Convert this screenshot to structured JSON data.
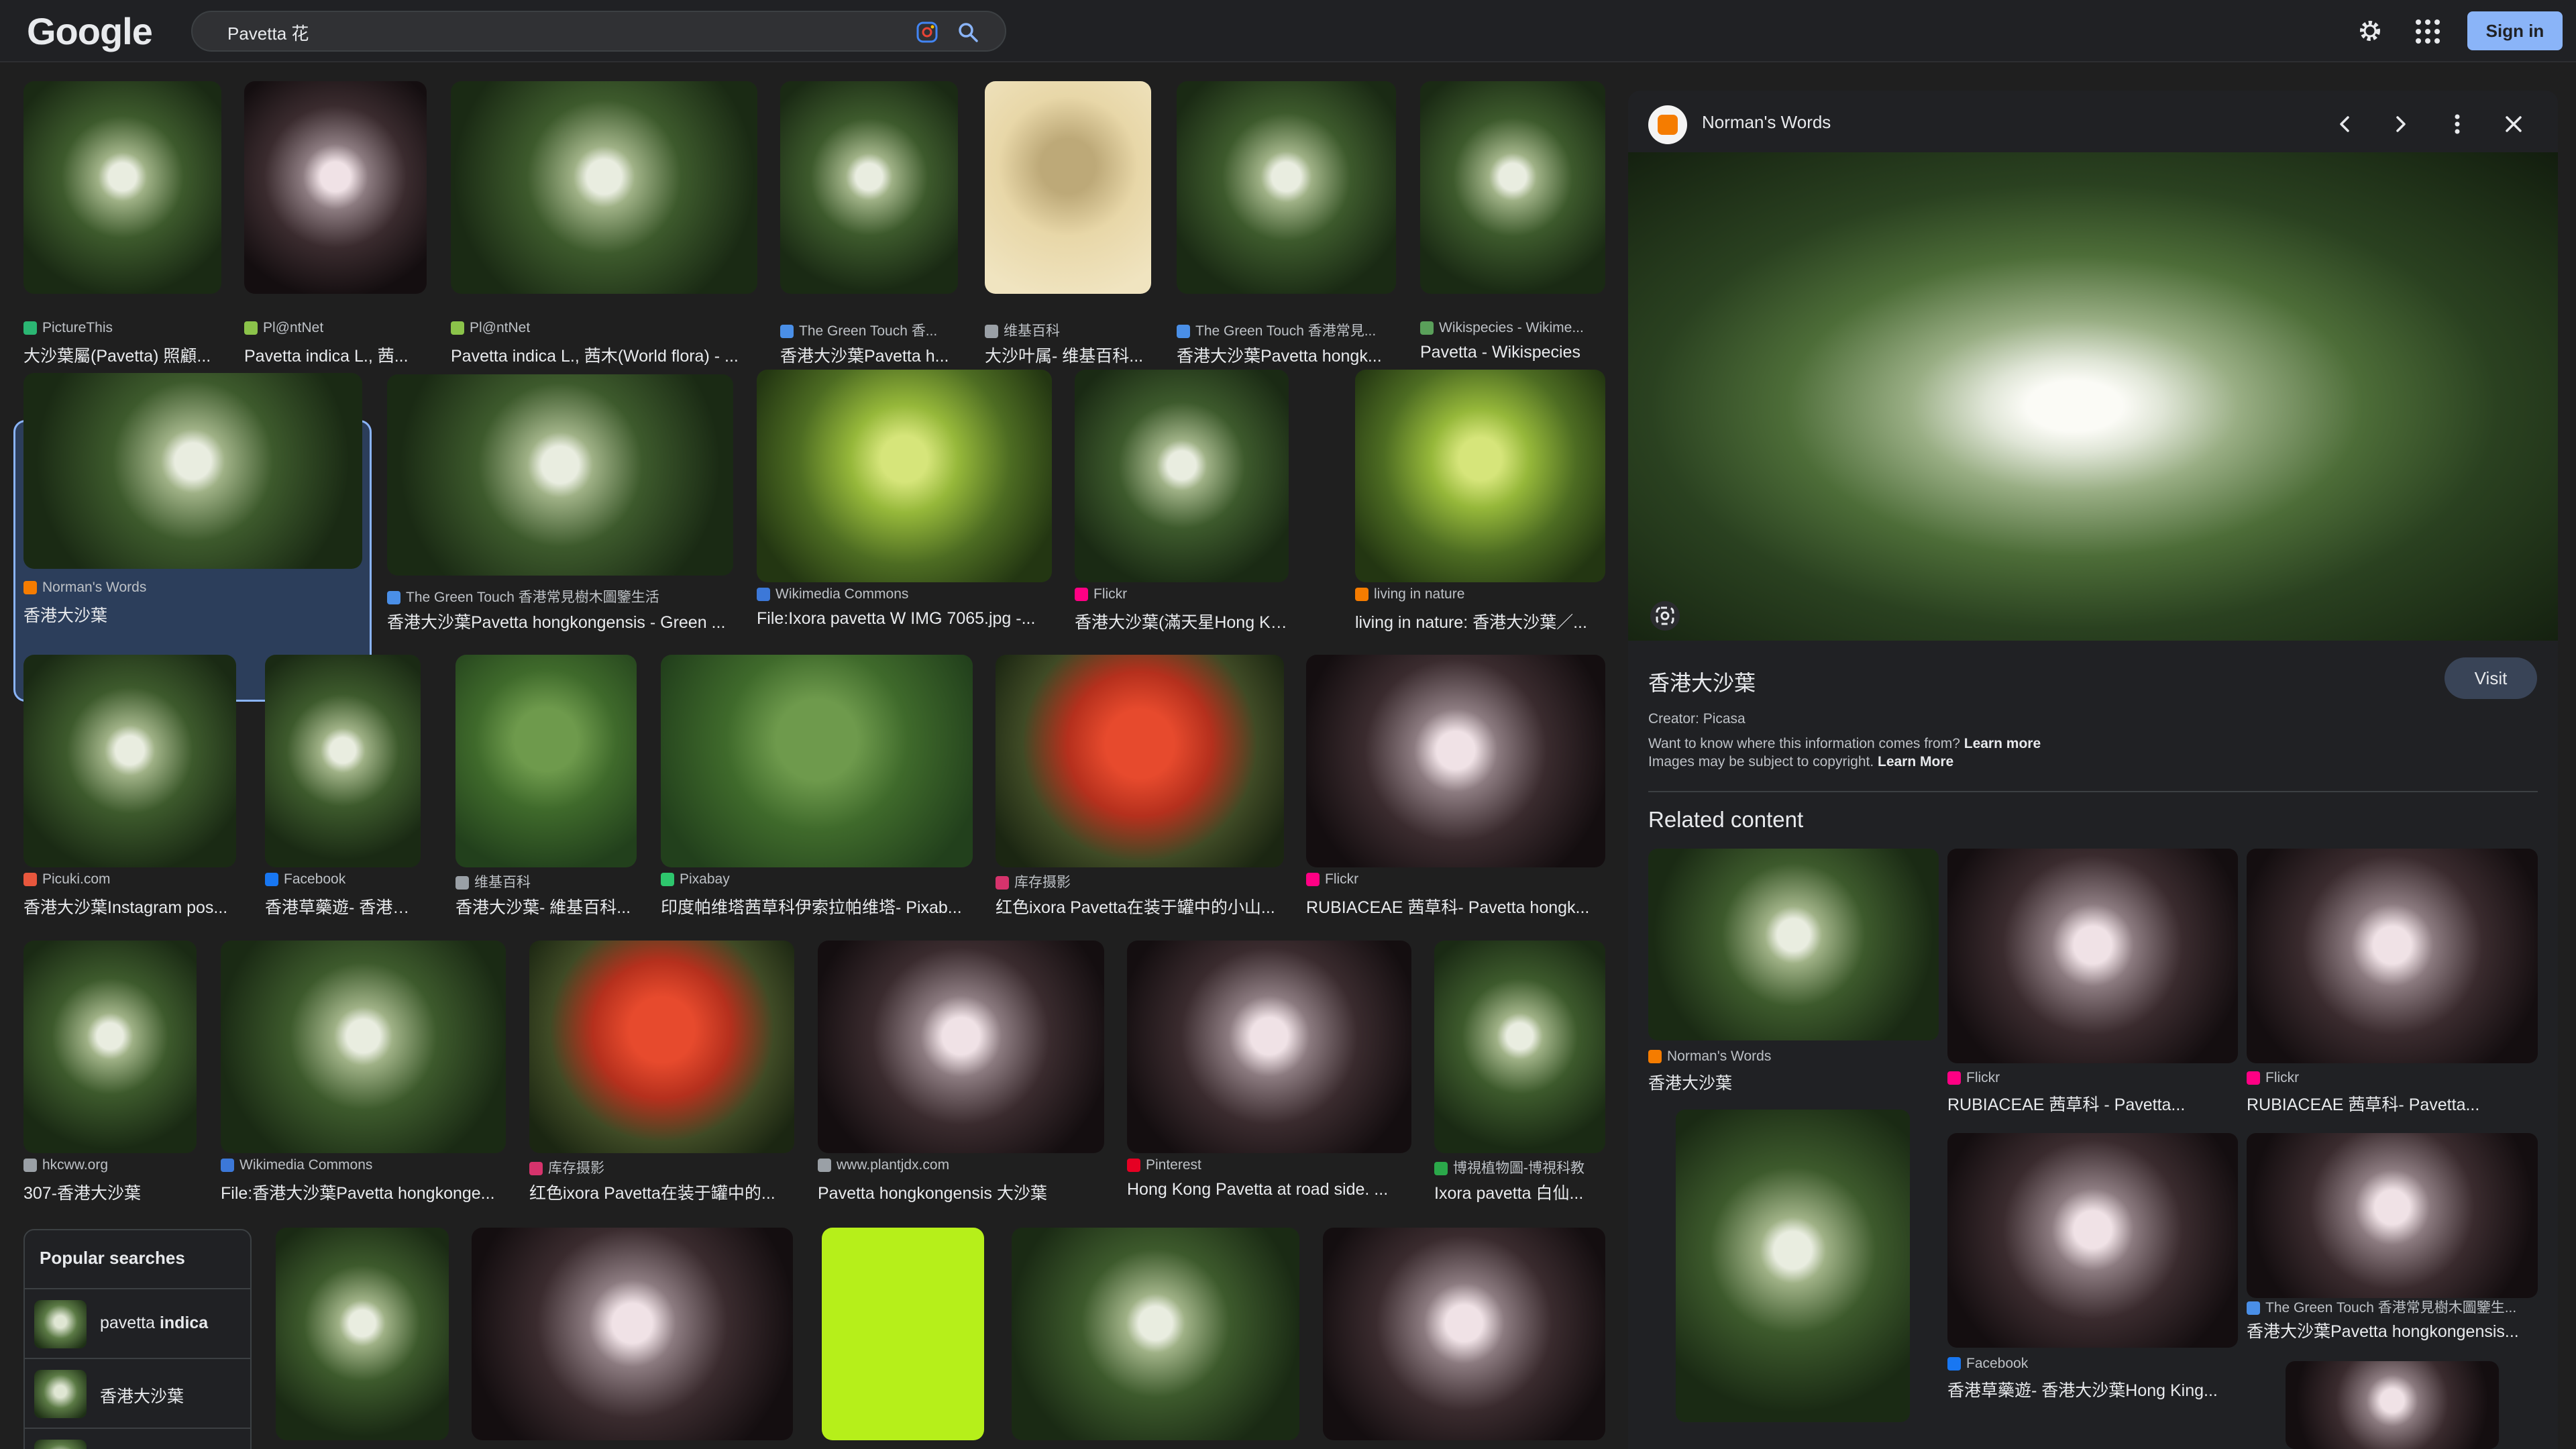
{
  "header": {
    "logo": "Google",
    "search_value": "Pavetta 花",
    "sign_in": "Sign in"
  },
  "grid": {
    "row1": [
      {
        "source": "PictureThis",
        "caption": "大沙葉屬(Pavetta) 照顧...",
        "fav": "#2bb673"
      },
      {
        "source": "Pl@ntNet",
        "caption": "Pavetta indica L., 茜...",
        "fav": "#8bc34a"
      },
      {
        "source": "Pl@ntNet",
        "caption": "Pavetta indica L., 茜木(World flora) - ...",
        "fav": "#8bc34a"
      },
      {
        "source": "The Green Touch 香...",
        "caption": "香港大沙葉Pavetta h...",
        "fav": "#4a8fe7"
      },
      {
        "source": "维基百科",
        "caption": "大沙叶属- 维基百科...",
        "fav": "#9aa0a6"
      },
      {
        "source": "The Green Touch 香港常見...",
        "caption": "香港大沙葉Pavetta hongk...",
        "fav": "#4a8fe7"
      },
      {
        "source": "Wikispecies - Wikime...",
        "caption": "Pavetta - Wikispecies",
        "fav": "#5aa05a"
      }
    ],
    "row2": [
      {
        "source": "Norman's Words",
        "caption": "香港大沙葉",
        "fav": "#f57c00"
      },
      {
        "source": "The Green Touch 香港常見樹木圖鑒生活",
        "caption": "香港大沙葉Pavetta hongkongensis - Green ...",
        "fav": "#4a8fe7"
      },
      {
        "source": "Wikimedia Commons",
        "caption": "File:Ixora pavetta W IMG 7065.jpg -...",
        "fav": "#3c78d8"
      },
      {
        "source": "Flickr",
        "caption": "香港大沙葉(滿天星Hong Kong ...",
        "fav": "#ff0084"
      },
      {
        "source": "living in nature",
        "caption": "living in nature: 香港大沙葉／...",
        "fav": "#f57c00"
      }
    ],
    "row3": [
      {
        "source": "Picuki.com",
        "caption": "香港大沙葉Instagram pos...",
        "fav": "#e8573d"
      },
      {
        "source": "Facebook",
        "caption": "香港草藥遊- 香港大...",
        "fav": "#1877f2"
      },
      {
        "source": "维基百科",
        "caption": "香港大沙葉- 維基百科...",
        "fav": "#9aa0a6"
      },
      {
        "source": "Pixabay",
        "caption": "印度帕维塔茜草科伊索拉帕维塔- Pixab...",
        "fav": "#2ec66d"
      },
      {
        "source": "库存摄影",
        "caption": "红色ixora Pavetta在装于罐中的小山...",
        "fav": "#d6336c"
      },
      {
        "source": "Flickr",
        "caption": "RUBIACEAE 茜草科- Pavetta hongk...",
        "fav": "#ff0084"
      }
    ],
    "row4": [
      {
        "source": "hkcww.org",
        "caption": "307-香港大沙葉",
        "fav": "#9aa0a6"
      },
      {
        "source": "Wikimedia Commons",
        "caption": "File:香港大沙葉Pavetta hongkonge...",
        "fav": "#3c78d8"
      },
      {
        "source": "库存摄影",
        "caption": "红色ixora Pavetta在装于罐中的...",
        "fav": "#d6336c"
      },
      {
        "source": "www.plantjdx.com",
        "caption": "Pavetta hongkongensis 大沙葉",
        "fav": "#9aa0a6"
      },
      {
        "source": "Pinterest",
        "caption": "Hong Kong Pavetta at road side. ...",
        "fav": "#e60023"
      },
      {
        "source": "博視植物圖-博視科教",
        "caption": "Ixora pavetta 白仙...",
        "fav": "#2ba84a"
      }
    ]
  },
  "popular": {
    "title": "Popular searches",
    "items": [
      {
        "text_plain": "pavetta ",
        "text_bold": "indica"
      },
      {
        "text_plain": "香港大沙葉",
        "text_bold": ""
      }
    ]
  },
  "panel": {
    "source": "Norman's Words",
    "title": "香港大沙葉",
    "visit": "Visit",
    "creator": "Creator: Picasa",
    "info_text": "Want to know where this information comes from? ",
    "info_link": "Learn more",
    "copy_text": "Images may be subject to copyright. ",
    "copy_link": "Learn More",
    "related_title": "Related content",
    "related": [
      {
        "source": "Norman's Words",
        "caption": "香港大沙葉",
        "fav": "#f57c00"
      },
      {
        "source": "Flickr",
        "caption": "RUBIACEAE 茜草科 - Pavetta...",
        "fav": "#ff0084"
      },
      {
        "source": "Flickr",
        "caption": "RUBIACEAE 茜草科- Pavetta...",
        "fav": "#ff0084"
      },
      {
        "source": "The Green Touch 香港常見樹木圖鑒生...",
        "caption": "香港大沙葉Pavetta hongkongensis...",
        "fav": "#4a8fe7"
      },
      {
        "source": "Facebook",
        "caption": "香港草藥遊- 香港大沙葉Hong King...",
        "fav": "#1877f2"
      }
    ]
  },
  "colors": {
    "accent": "#8ab4f8",
    "background": "#1f1f1f"
  }
}
